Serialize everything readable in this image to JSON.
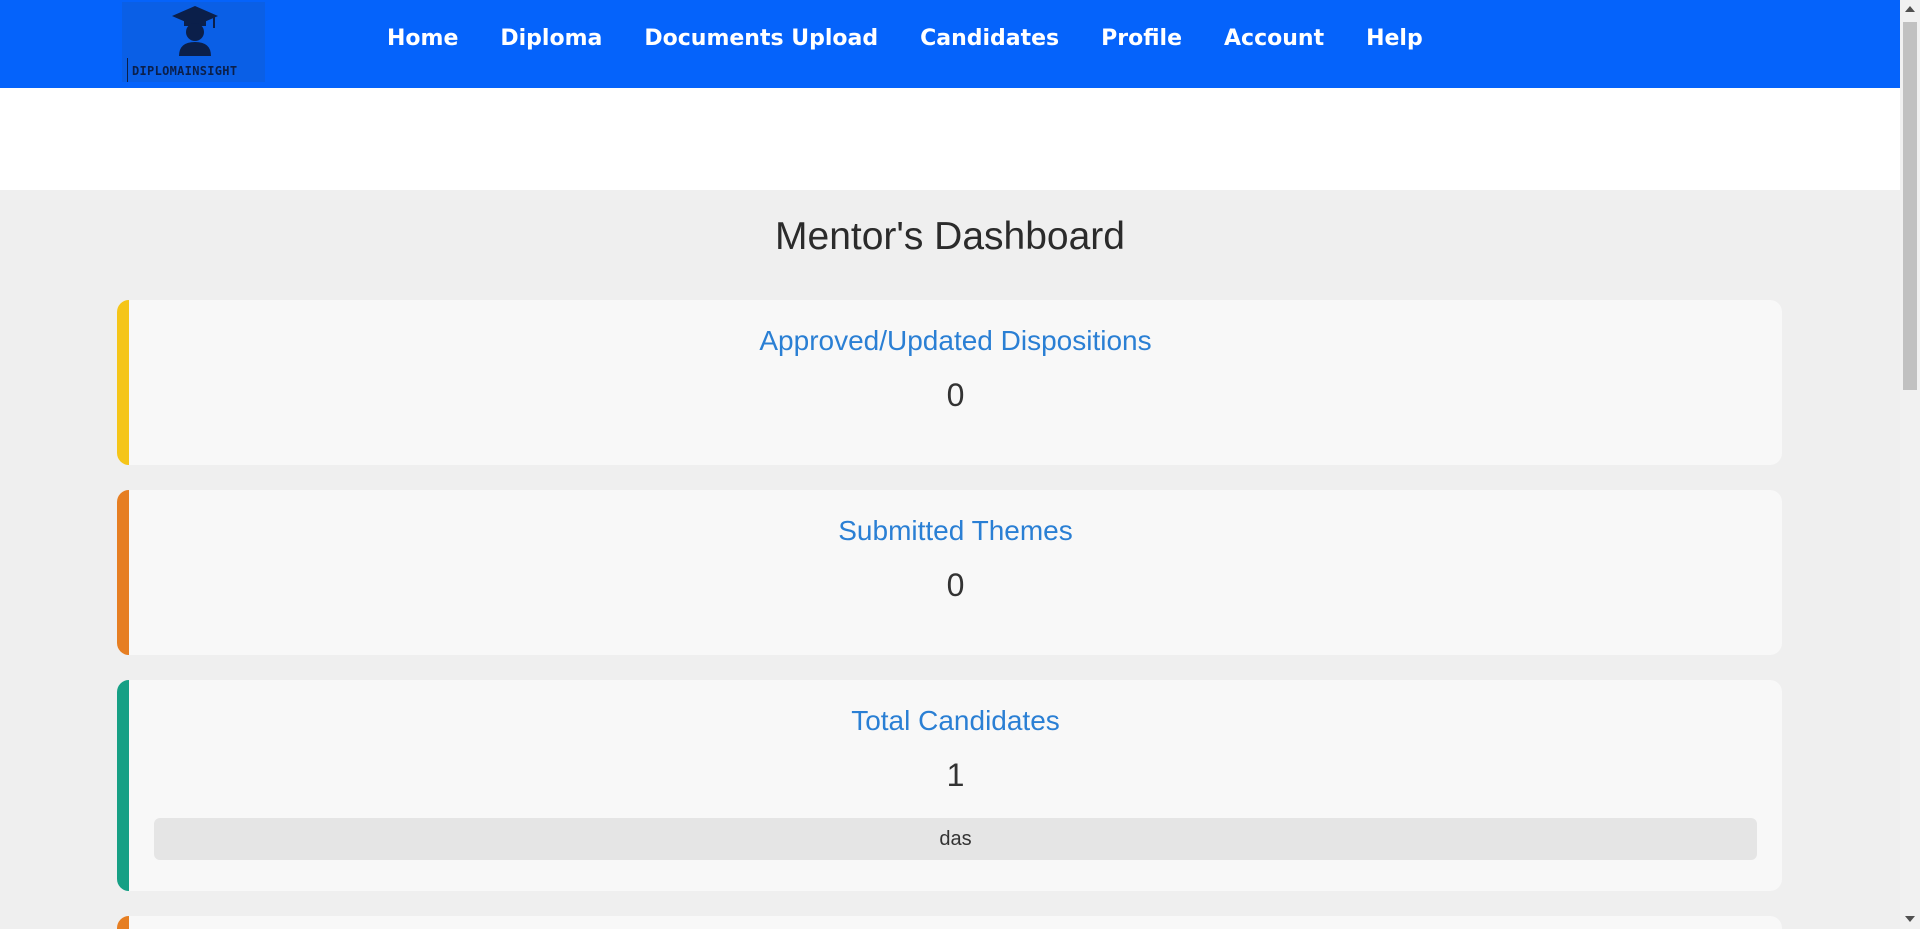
{
  "brand": {
    "logo_text": "DIPLOMAINSIGHT",
    "icon": "graduate-cap-icon"
  },
  "nav": {
    "items": [
      {
        "label": "Home"
      },
      {
        "label": "Diploma"
      },
      {
        "label": "Documents Upload"
      },
      {
        "label": "Candidates"
      },
      {
        "label": "Profile"
      },
      {
        "label": "Account"
      },
      {
        "label": "Help"
      }
    ]
  },
  "page": {
    "title": "Mentor's Dashboard"
  },
  "cards": [
    {
      "title": "Approved/Updated Dispositions",
      "value": "0",
      "accent": "#f5c518"
    },
    {
      "title": "Submitted Themes",
      "value": "0",
      "accent": "#e67e22"
    },
    {
      "title": "Total Candidates",
      "value": "1",
      "accent": "#16a085",
      "candidates": [
        "das"
      ]
    },
    {
      "accent": "#e67e22"
    }
  ],
  "colors": {
    "navbar": "#0563fb",
    "card_title": "#2a7fd4",
    "background": "#efefef"
  }
}
